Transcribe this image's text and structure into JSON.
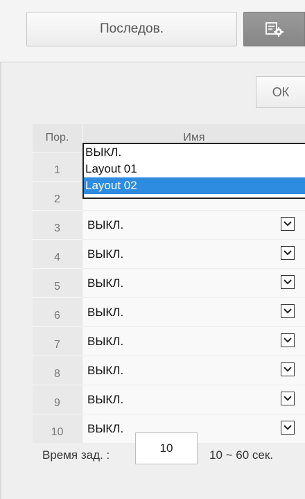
{
  "toolbar": {
    "sequence_label": "Последов.",
    "settings_icon": "settings-gear-icon",
    "ok_label": "ОК"
  },
  "table": {
    "header_order": "Пор.",
    "header_name": "Имя",
    "rows": [
      {
        "num": "1",
        "value": ""
      },
      {
        "num": "2",
        "value": ""
      },
      {
        "num": "3",
        "value": "ВЫКЛ."
      },
      {
        "num": "4",
        "value": "ВЫКЛ."
      },
      {
        "num": "5",
        "value": "ВЫКЛ."
      },
      {
        "num": "6",
        "value": "ВЫКЛ."
      },
      {
        "num": "7",
        "value": "ВЫКЛ."
      },
      {
        "num": "8",
        "value": "ВЫКЛ."
      },
      {
        "num": "9",
        "value": "ВЫКЛ."
      },
      {
        "num": "10",
        "value": "ВЫКЛ."
      }
    ]
  },
  "dropdown": {
    "options": [
      "ВЫКЛ.",
      "Layout 01",
      "Layout 02"
    ],
    "selected": "Layout 02"
  },
  "footer": {
    "delay_label": "Время зад. :",
    "delay_value": "10",
    "delay_range": "10 ~ 60 сек."
  },
  "colors": {
    "selection": "#2d8be0",
    "settings_button": "#8f8f8f"
  }
}
